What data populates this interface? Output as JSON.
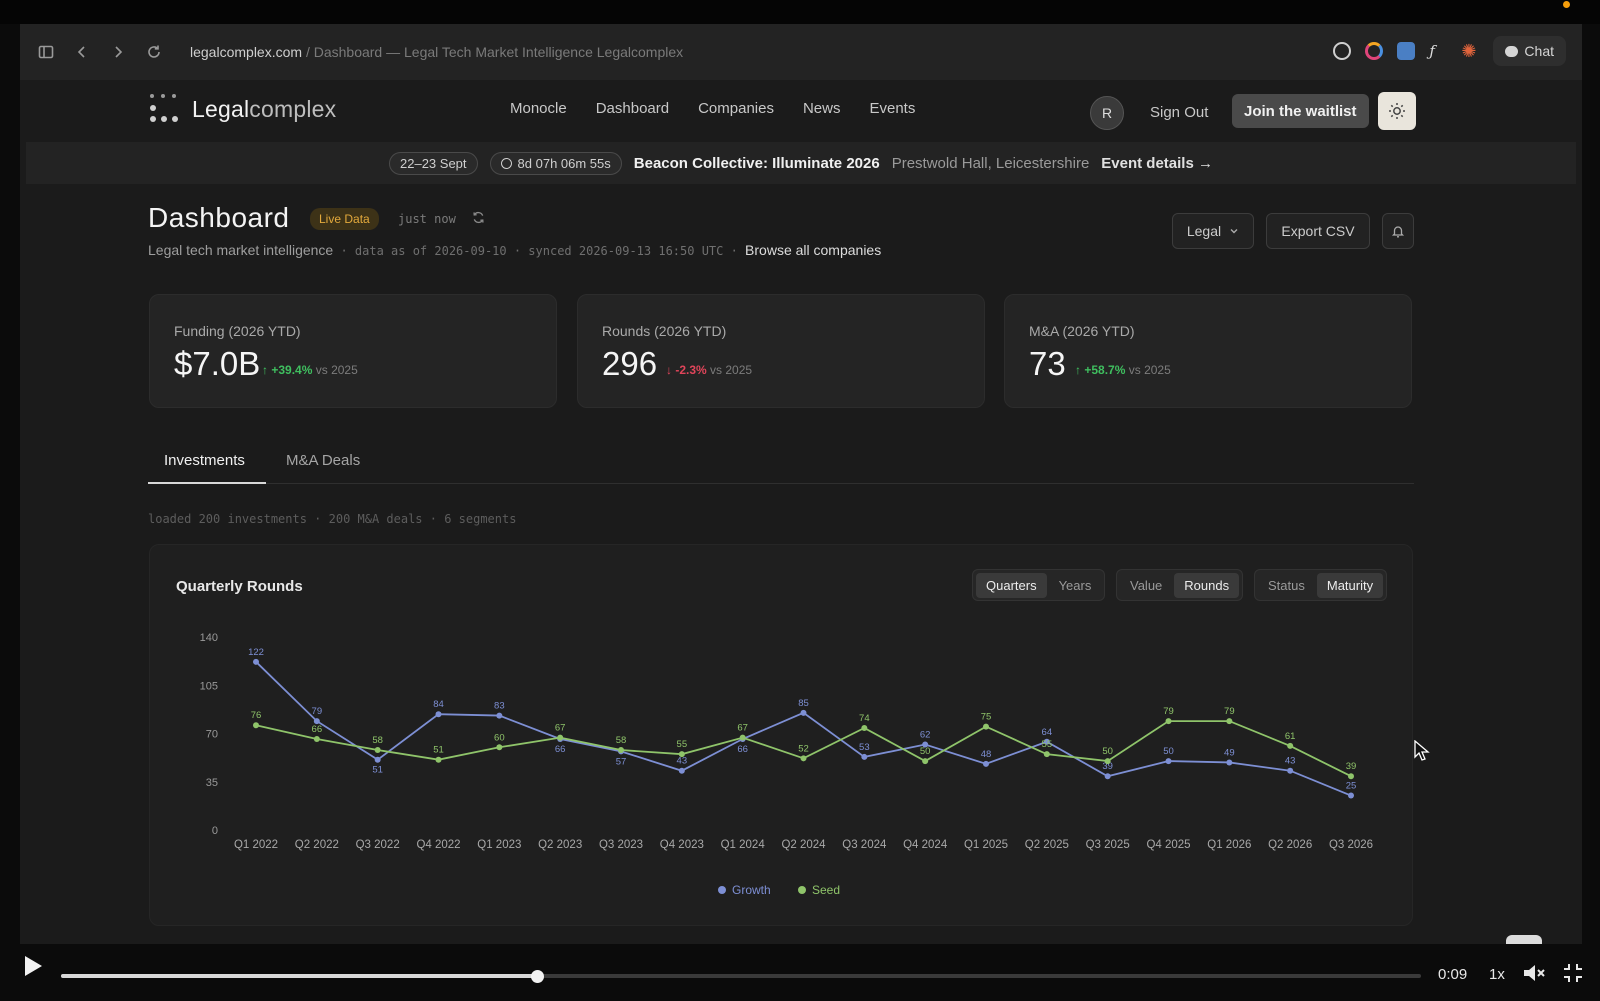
{
  "browser": {
    "domain": "legalcomplex.com",
    "path": " / Dashboard — Legal Tech Market Intelligence Legalcomplex",
    "chat_label": "Chat"
  },
  "nav": {
    "logo_bold": "Legal",
    "logo_thin": "complex",
    "links": [
      "Monocle",
      "Dashboard",
      "Companies",
      "News",
      "Events"
    ],
    "avatar_initial": "R",
    "sign_out": "Sign Out",
    "waitlist": "Join the waitlist"
  },
  "banner": {
    "dates": "22–23 Sept",
    "countdown": "8d 07h 06m 55s",
    "title": "Beacon Collective: Illuminate 2026",
    "venue": "Prestwold Hall, Leicestershire",
    "link": "Event details →"
  },
  "header": {
    "title": "Dashboard",
    "badge": "Live Data",
    "updated": "just now",
    "subtitle": "Legal tech market intelligence",
    "meta": " · data as of 2026-09-10 · synced 2026-09-13 16:50 UTC · ",
    "browse": "Browse all companies",
    "filter": "Legal",
    "export": "Export CSV"
  },
  "stats": [
    {
      "label": "Funding (2026 YTD)",
      "value": "$7.0B",
      "delta": "+39.4%",
      "direction": "up",
      "vs": "vs 2025"
    },
    {
      "label": "Rounds (2026 YTD)",
      "value": "296",
      "delta": "-2.3%",
      "direction": "down",
      "vs": "vs 2025"
    },
    {
      "label": "M&A (2026 YTD)",
      "value": "73",
      "delta": "+58.7%",
      "direction": "up",
      "vs": "vs 2025"
    }
  ],
  "tabs": [
    "Investments",
    "M&A Deals"
  ],
  "loaded_text": "loaded 200 investments · 200 M&A deals · 6 segments",
  "chart_card": {
    "title": "Quarterly Rounds",
    "period_options": [
      "Quarters",
      "Years"
    ],
    "period_selected": "Quarters",
    "metric_options": [
      "Value",
      "Rounds"
    ],
    "metric_selected": "Rounds",
    "group_options": [
      "Status",
      "Maturity"
    ],
    "group_selected": "Maturity"
  },
  "chart_data": {
    "type": "line",
    "title": "Quarterly Rounds",
    "categories": [
      "Q1 2022",
      "Q2 2022",
      "Q3 2022",
      "Q4 2022",
      "Q1 2023",
      "Q2 2023",
      "Q3 2023",
      "Q4 2023",
      "Q1 2024",
      "Q2 2024",
      "Q3 2024",
      "Q4 2024",
      "Q1 2025",
      "Q2 2025",
      "Q3 2025",
      "Q4 2025",
      "Q1 2026",
      "Q2 2026",
      "Q3 2026"
    ],
    "ylim": [
      0,
      140
    ],
    "yticks": [
      0,
      35,
      70,
      105,
      140
    ],
    "grid": false,
    "legend": "bottom",
    "series": [
      {
        "name": "Growth",
        "color": "#7d8fd4",
        "values": [
          122,
          79,
          51,
          84,
          83,
          66,
          57,
          43,
          66,
          85,
          53,
          62,
          48,
          64,
          39,
          50,
          49,
          43,
          25
        ]
      },
      {
        "name": "Seed",
        "color": "#8fc46a",
        "values": [
          76,
          66,
          58,
          51,
          60,
          67,
          58,
          55,
          67,
          52,
          74,
          50,
          75,
          55,
          50,
          79,
          79,
          61,
          39
        ]
      }
    ]
  },
  "video": {
    "time": "0:09",
    "speed": "1x",
    "progress": 0.35
  },
  "colors": {
    "accent_badge": "#e3a93c",
    "up": "#3fbf5f",
    "down": "#e0455a"
  }
}
